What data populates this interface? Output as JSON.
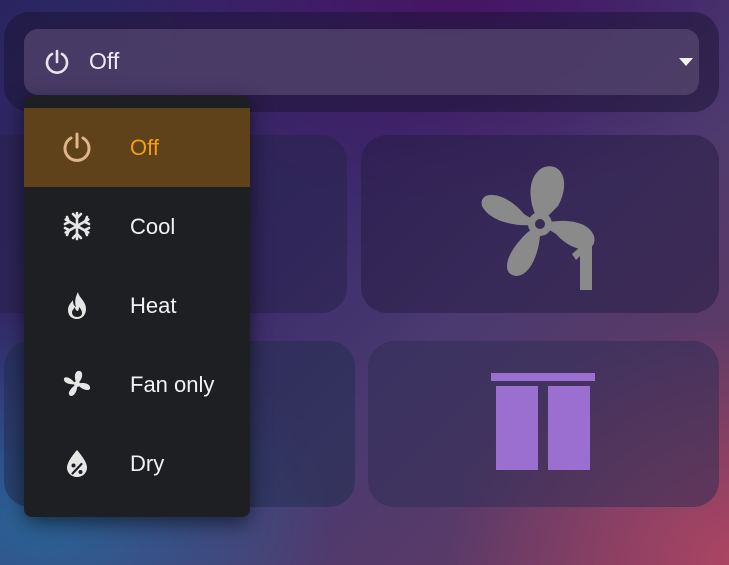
{
  "select": {
    "value": "Off",
    "icon": "power-icon"
  },
  "menu": {
    "items": [
      {
        "label": "Off",
        "icon": "power-icon",
        "selected": true
      },
      {
        "label": "Cool",
        "icon": "snowflake-icon",
        "selected": false
      },
      {
        "label": "Heat",
        "icon": "fire-icon",
        "selected": false
      },
      {
        "label": "Fan only",
        "icon": "fan-icon",
        "selected": false
      },
      {
        "label": "Dry",
        "icon": "water-percent-icon",
        "selected": false
      }
    ]
  },
  "cards": [
    {
      "icon": "fan-off-icon"
    },
    {
      "icon": "fan-speed-1-icon"
    },
    {
      "icon": "curtains-icon"
    },
    {
      "icon": "window-shutter-open-icon"
    }
  ],
  "colors": {
    "accent": "#f39c1a",
    "selected_bg": "#5a3c14",
    "menu_bg": "#1e1f22",
    "fan_off": "#b2341f",
    "fan_gray": "#8a8a8a",
    "window_purple": "#9a6fd0"
  }
}
